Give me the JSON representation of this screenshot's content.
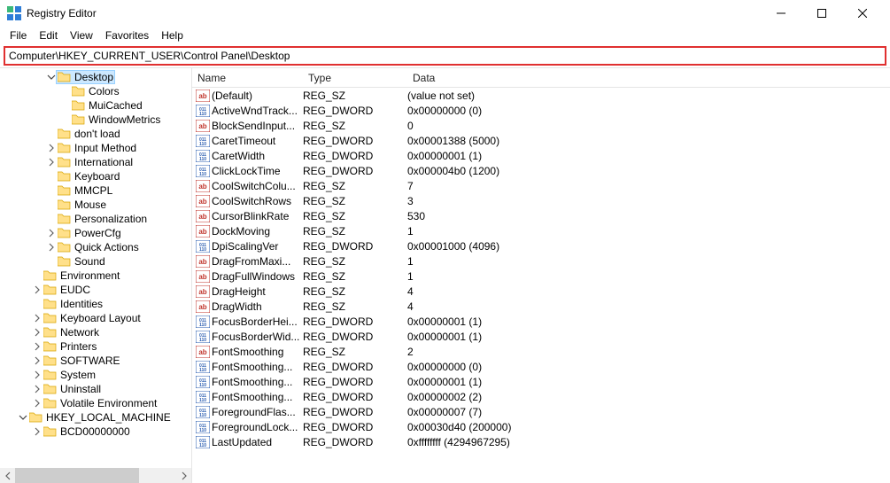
{
  "window": {
    "title": "Registry Editor"
  },
  "menubar": {
    "items": [
      "File",
      "Edit",
      "View",
      "Favorites",
      "Help"
    ]
  },
  "address": {
    "path": "Computer\\HKEY_CURRENT_USER\\Control Panel\\Desktop"
  },
  "tree": {
    "nodes": [
      {
        "label": "Desktop",
        "indent": 3,
        "exp": "down",
        "selected": true
      },
      {
        "label": "Colors",
        "indent": 4,
        "exp": ""
      },
      {
        "label": "MuiCached",
        "indent": 4,
        "exp": ""
      },
      {
        "label": "WindowMetrics",
        "indent": 4,
        "exp": ""
      },
      {
        "label": "don't load",
        "indent": 3,
        "exp": ""
      },
      {
        "label": "Input Method",
        "indent": 3,
        "exp": "right"
      },
      {
        "label": "International",
        "indent": 3,
        "exp": "right"
      },
      {
        "label": "Keyboard",
        "indent": 3,
        "exp": ""
      },
      {
        "label": "MMCPL",
        "indent": 3,
        "exp": ""
      },
      {
        "label": "Mouse",
        "indent": 3,
        "exp": ""
      },
      {
        "label": "Personalization",
        "indent": 3,
        "exp": ""
      },
      {
        "label": "PowerCfg",
        "indent": 3,
        "exp": "right"
      },
      {
        "label": "Quick Actions",
        "indent": 3,
        "exp": "right"
      },
      {
        "label": "Sound",
        "indent": 3,
        "exp": ""
      },
      {
        "label": "Environment",
        "indent": 2,
        "exp": ""
      },
      {
        "label": "EUDC",
        "indent": 2,
        "exp": "right"
      },
      {
        "label": "Identities",
        "indent": 2,
        "exp": ""
      },
      {
        "label": "Keyboard Layout",
        "indent": 2,
        "exp": "right"
      },
      {
        "label": "Network",
        "indent": 2,
        "exp": "right"
      },
      {
        "label": "Printers",
        "indent": 2,
        "exp": "right"
      },
      {
        "label": "SOFTWARE",
        "indent": 2,
        "exp": "right"
      },
      {
        "label": "System",
        "indent": 2,
        "exp": "right"
      },
      {
        "label": "Uninstall",
        "indent": 2,
        "exp": "right"
      },
      {
        "label": "Volatile Environment",
        "indent": 2,
        "exp": "right"
      },
      {
        "label": "HKEY_LOCAL_MACHINE",
        "indent": 1,
        "exp": "down"
      },
      {
        "label": "BCD00000000",
        "indent": 2,
        "exp": "right"
      }
    ]
  },
  "list": {
    "columns": {
      "name": "Name",
      "type": "Type",
      "data": "Data"
    },
    "rows": [
      {
        "name": "(Default)",
        "type": "REG_SZ",
        "data": "(value not set)",
        "kind": "sz"
      },
      {
        "name": "ActiveWndTrack...",
        "type": "REG_DWORD",
        "data": "0x00000000 (0)",
        "kind": "bin"
      },
      {
        "name": "BlockSendInput...",
        "type": "REG_SZ",
        "data": "0",
        "kind": "sz"
      },
      {
        "name": "CaretTimeout",
        "type": "REG_DWORD",
        "data": "0x00001388 (5000)",
        "kind": "bin"
      },
      {
        "name": "CaretWidth",
        "type": "REG_DWORD",
        "data": "0x00000001 (1)",
        "kind": "bin"
      },
      {
        "name": "ClickLockTime",
        "type": "REG_DWORD",
        "data": "0x000004b0 (1200)",
        "kind": "bin"
      },
      {
        "name": "CoolSwitchColu...",
        "type": "REG_SZ",
        "data": "7",
        "kind": "sz"
      },
      {
        "name": "CoolSwitchRows",
        "type": "REG_SZ",
        "data": "3",
        "kind": "sz"
      },
      {
        "name": "CursorBlinkRate",
        "type": "REG_SZ",
        "data": "530",
        "kind": "sz"
      },
      {
        "name": "DockMoving",
        "type": "REG_SZ",
        "data": "1",
        "kind": "sz"
      },
      {
        "name": "DpiScalingVer",
        "type": "REG_DWORD",
        "data": "0x00001000 (4096)",
        "kind": "bin"
      },
      {
        "name": "DragFromMaxi...",
        "type": "REG_SZ",
        "data": "1",
        "kind": "sz"
      },
      {
        "name": "DragFullWindows",
        "type": "REG_SZ",
        "data": "1",
        "kind": "sz"
      },
      {
        "name": "DragHeight",
        "type": "REG_SZ",
        "data": "4",
        "kind": "sz"
      },
      {
        "name": "DragWidth",
        "type": "REG_SZ",
        "data": "4",
        "kind": "sz"
      },
      {
        "name": "FocusBorderHei...",
        "type": "REG_DWORD",
        "data": "0x00000001 (1)",
        "kind": "bin"
      },
      {
        "name": "FocusBorderWid...",
        "type": "REG_DWORD",
        "data": "0x00000001 (1)",
        "kind": "bin"
      },
      {
        "name": "FontSmoothing",
        "type": "REG_SZ",
        "data": "2",
        "kind": "sz"
      },
      {
        "name": "FontSmoothing...",
        "type": "REG_DWORD",
        "data": "0x00000000 (0)",
        "kind": "bin"
      },
      {
        "name": "FontSmoothing...",
        "type": "REG_DWORD",
        "data": "0x00000001 (1)",
        "kind": "bin"
      },
      {
        "name": "FontSmoothing...",
        "type": "REG_DWORD",
        "data": "0x00000002 (2)",
        "kind": "bin"
      },
      {
        "name": "ForegroundFlas...",
        "type": "REG_DWORD",
        "data": "0x00000007 (7)",
        "kind": "bin"
      },
      {
        "name": "ForegroundLock...",
        "type": "REG_DWORD",
        "data": "0x00030d40 (200000)",
        "kind": "bin"
      },
      {
        "name": "LastUpdated",
        "type": "REG_DWORD",
        "data": "0xffffffff (4294967295)",
        "kind": "bin"
      }
    ]
  }
}
